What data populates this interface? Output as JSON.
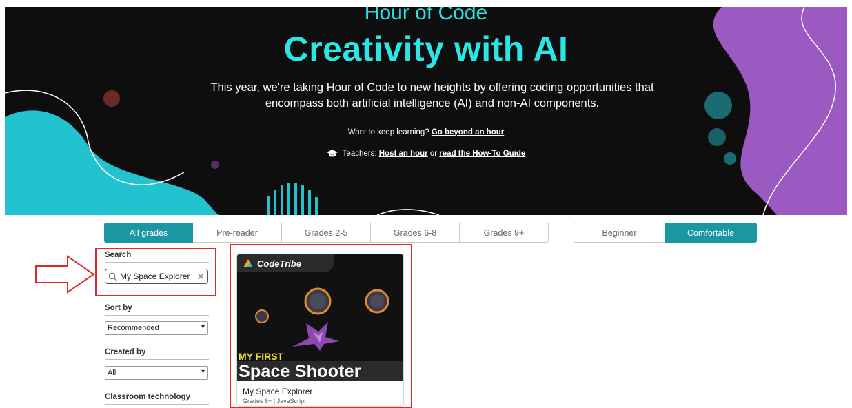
{
  "hero": {
    "eyebrow": "Hour of Code",
    "title": "Creativity with AI",
    "description": "This year, we're taking Hour of Code to new heights by offering coding opportunities that encompass both artificial intelligence (AI) and non-AI components.",
    "keep_learning_prefix": "Want to keep learning?",
    "keep_learning_link": "Go beyond an hour",
    "teachers_prefix": "Teachers:",
    "teachers_link1": "Host an hour",
    "teachers_or": "or",
    "teachers_link2": "read the How-To Guide",
    "accent_color": "#2ae6e6"
  },
  "grade_tabs": [
    {
      "label": "All grades",
      "active": true
    },
    {
      "label": "Pre-reader",
      "active": false
    },
    {
      "label": "Grades 2-5",
      "active": false
    },
    {
      "label": "Grades 6-8",
      "active": false
    },
    {
      "label": "Grades 9+",
      "active": false
    }
  ],
  "level_tabs": [
    {
      "label": "Beginner",
      "active": false
    },
    {
      "label": "Comfortable",
      "active": true
    }
  ],
  "filters": {
    "search_label": "Search",
    "search_value": "My Space Explorer",
    "sort_label": "Sort by",
    "sort_value": "Recommended",
    "created_label": "Created by",
    "created_value": "All",
    "classroom_label": "Classroom technology"
  },
  "card": {
    "brand": "CodeTribe",
    "image_line1": "MY FIRST",
    "image_line2": "Space Shooter",
    "title": "My Space Explorer",
    "meta": "Grades 6+ | JavaScript"
  },
  "colors": {
    "tab_active": "#1b97a3",
    "highlight_red": "#e3262a"
  }
}
